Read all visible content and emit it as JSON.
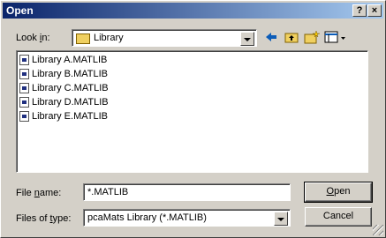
{
  "titlebar": {
    "title": "Open",
    "help_label": "?",
    "close_label": "×"
  },
  "lookin": {
    "label_pre": "Look ",
    "label_key": "i",
    "label_post": "n:",
    "value": "Library"
  },
  "files": [
    "Library A.MATLIB",
    "Library B.MATLIB",
    "Library C.MATLIB",
    "Library D.MATLIB",
    "Library E.MATLIB"
  ],
  "filename": {
    "label_pre": "File ",
    "label_key": "n",
    "label_post": "ame:",
    "value": "*.MATLIB"
  },
  "filetype": {
    "label_pre": "Files of ",
    "label_key": "t",
    "label_post": "ype:",
    "value": "pcaMats Library (*.MATLIB)"
  },
  "buttons": {
    "open_key": "O",
    "open_rest": "pen",
    "cancel": "Cancel"
  },
  "colors": {
    "title_start": "#0a246a",
    "title_end": "#a6caf0",
    "face": "#d4d0c8"
  },
  "icons": [
    "help-icon",
    "close-icon",
    "folder-icon",
    "back-icon",
    "up-folder-icon",
    "new-folder-icon",
    "view-menu-icon",
    "file-icon"
  ]
}
